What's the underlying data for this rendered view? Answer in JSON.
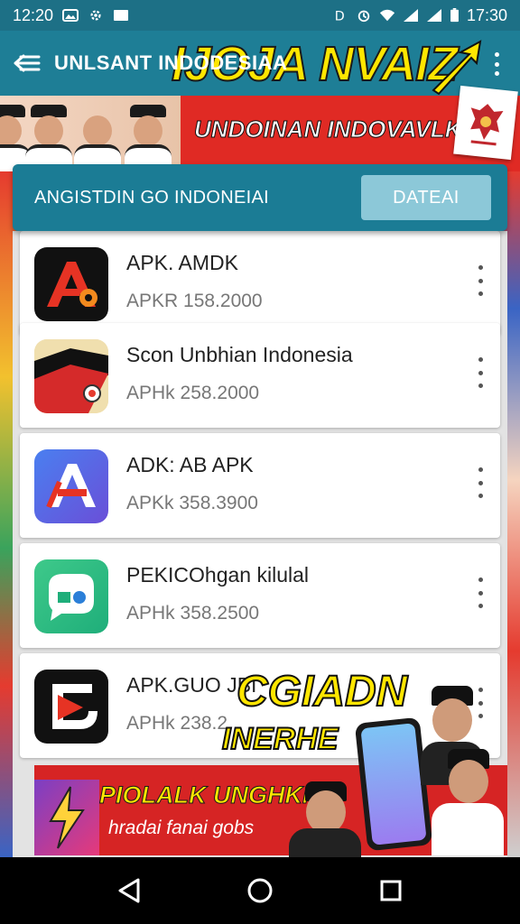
{
  "status_bar": {
    "time_left": "12:20",
    "time_right": "17:30"
  },
  "app_bar": {
    "title": "UNLSANT INDODESIAA"
  },
  "top_banner": {
    "headline": "IJOJA NVAIZ",
    "subtitle": "UNDOINAN INDOVAVLK"
  },
  "header_card": {
    "title": "ANGISTDIN GO INDONEIAI",
    "button_label": "DATEAI"
  },
  "apps": [
    {
      "name": "APK. AMDK",
      "meta": "APKR  158.2000",
      "icon": "red-a-icon"
    },
    {
      "name": "Scon Unbhian Indonesia",
      "meta": "APHk  258.2000",
      "icon": "flag-folder-icon"
    },
    {
      "name": "ADK: AB APK",
      "meta": "APKk  358.3900",
      "icon": "blue-a-icon"
    },
    {
      "name": "PEKICOhgan kilulal",
      "meta": "APHk  358.2500",
      "icon": "green-chat-icon"
    },
    {
      "name": "APK.GUO JBI",
      "meta": "APHk  238.2",
      "icon": "red-play-icon"
    }
  ],
  "promo": {
    "headline_1": "CGIADN",
    "headline_2": "INERHE",
    "title": "PIOLALK UNGHKNIU",
    "subtitle": "hradai fanai gobs"
  },
  "colors": {
    "primary": "#1e7e96",
    "accent_red": "#e02a24",
    "accent_yellow": "#ffe600"
  }
}
